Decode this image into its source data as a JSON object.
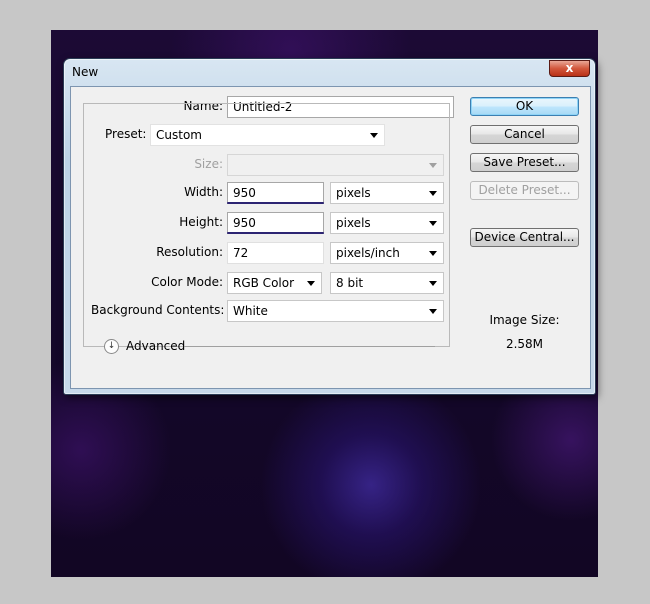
{
  "dialog": {
    "title": "New",
    "close_label": "x"
  },
  "form": {
    "name_label": "Name:",
    "name_value": "Untitled-2",
    "preset_label": "Preset:",
    "preset_value": "Custom",
    "size_label": "Size:",
    "size_value": "",
    "width_label": "Width:",
    "width_value": "950",
    "width_unit": "pixels",
    "height_label": "Height:",
    "height_value": "950",
    "height_unit": "pixels",
    "resolution_label": "Resolution:",
    "resolution_value": "72",
    "resolution_unit": "pixels/inch",
    "color_mode_label": "Color Mode:",
    "color_mode_value": "RGB Color",
    "bit_depth_value": "8 bit",
    "background_label": "Background Contents:",
    "background_value": "White",
    "advanced_label": "Advanced"
  },
  "buttons": {
    "ok": "OK",
    "cancel": "Cancel",
    "save_preset": "Save Preset...",
    "delete_preset": "Delete Preset...",
    "device_central": "Device Central..."
  },
  "info": {
    "image_size_label": "Image Size:",
    "image_size_value": "2.58M"
  },
  "icons": {
    "close": "close-icon",
    "dropdown": "chevron-down-icon",
    "advanced": "double-chevron-down-icon"
  },
  "colors": {
    "annotation_underline": "#2c2473",
    "default_button": "#a7d9f5",
    "close_button": "#c64428"
  }
}
